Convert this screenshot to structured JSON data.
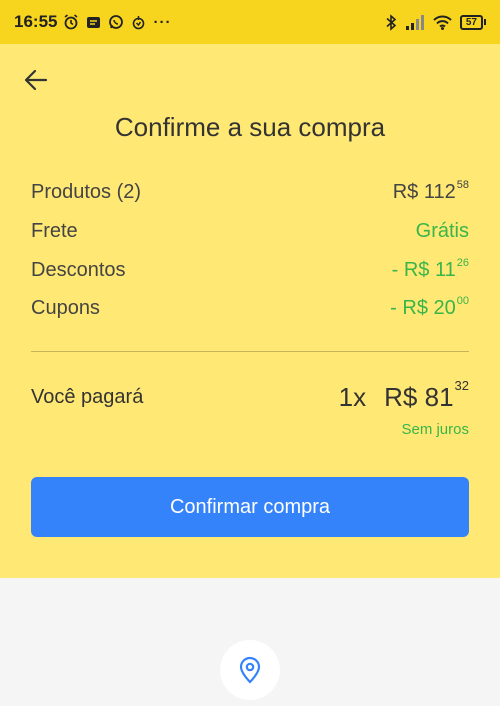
{
  "status_bar": {
    "time": "16:55",
    "battery": "57",
    "more": "···"
  },
  "header": {
    "title": "Confirme a sua compra"
  },
  "summary": {
    "produtos": {
      "label": "Produtos (2)",
      "currency": "R$ ",
      "int": "112",
      "cents": "58"
    },
    "frete": {
      "label": "Frete",
      "value": "Grátis"
    },
    "descontos": {
      "label": "Descontos",
      "currency": "- R$ ",
      "int": "11",
      "cents": "26"
    },
    "cupons": {
      "label": "Cupons",
      "currency": "- R$ ",
      "int": "20",
      "cents": "00"
    }
  },
  "total": {
    "label": "Você pagará",
    "installments": "1x",
    "currency": "R$ ",
    "int": "81",
    "cents": "32",
    "interest": "Sem juros"
  },
  "actions": {
    "confirm_label": "Confirmar compra"
  },
  "colors": {
    "panel": "#ffe873",
    "status_bar": "#f7d51e",
    "button": "#3483fa",
    "green": "#39b54a"
  }
}
